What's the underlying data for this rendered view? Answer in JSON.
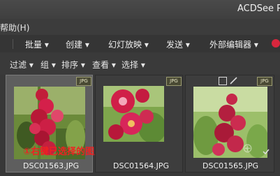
{
  "app": {
    "title": "ACDSee P"
  },
  "menu": {
    "help": "帮助(H)"
  },
  "toolbar": {
    "items": [
      "批量 ▾",
      "创建 ▾",
      "幻灯放映 ▾",
      "发送 ▾",
      "外部编辑器 ▾"
    ]
  },
  "subbar": {
    "items": [
      "过滤 ▾",
      "组 ▾",
      "排序 ▾",
      "查看 ▾",
      "选择 ▾"
    ]
  },
  "thumbnails": [
    {
      "name": "DSC01563.JPG",
      "badge": "JPG",
      "selected": true
    },
    {
      "name": "DSC01564.JPG",
      "badge": "JPG",
      "selected": false
    },
    {
      "name": "DSC01565.JPG",
      "badge": "JPG",
      "selected": false
    }
  ],
  "annotation": "①右键已选择的图片",
  "colors": {
    "annotation": "#e22222",
    "selection": "#5e5e5e",
    "background": "#3b3b3b"
  }
}
